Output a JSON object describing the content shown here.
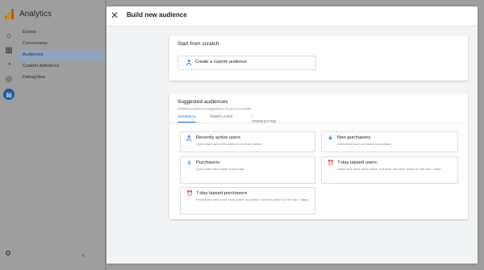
{
  "app": {
    "name": "Analytics",
    "nav_items": [
      "Events",
      "Conversions",
      "Audiences",
      "Custom definitions",
      "DebugView"
    ],
    "active_nav": "Audiences",
    "brand_colors": {
      "logo_orange": "#f9ab00",
      "logo_dark_orange": "#e37400",
      "active_blue": "#1a73e8"
    }
  },
  "sheet": {
    "title": "Build new audience",
    "close_icon": "close-icon"
  },
  "scratch": {
    "heading": "Start from scratch",
    "create_label": "Create a custom audience",
    "icon": "person-icon"
  },
  "suggested": {
    "heading": "Suggested audiences",
    "subheading": "Additional audience suggestions for you to consider",
    "tabs": [
      {
        "label": "GENERAL",
        "active": true
      },
      {
        "label": "TEMPLATES",
        "active": false
      },
      {
        "label": "PREDICTIVE",
        "active": false,
        "icon": "magic-wand-icon"
      }
    ],
    "items": [
      {
        "title": "Recently active users",
        "desc": "Users that have been active in a recent period",
        "icon": "person-icon"
      },
      {
        "title": "Non-purchasers",
        "desc": "Users that have not made a purchase",
        "icon": "no-dollar-icon"
      },
      {
        "title": "Purchasers",
        "desc": "Users that have made a purchase",
        "icon": "dollar-icon"
      },
      {
        "title": "7-day lapsed users",
        "desc": "Users who were once active, but have not been active for the last 7 days.",
        "icon": "alarm-icon"
      },
      {
        "title": "7-day lapsed purchasers",
        "desc": "Purchasers who were once active, but have not been active for the last 7 days.",
        "icon": "alarm-icon"
      }
    ]
  }
}
